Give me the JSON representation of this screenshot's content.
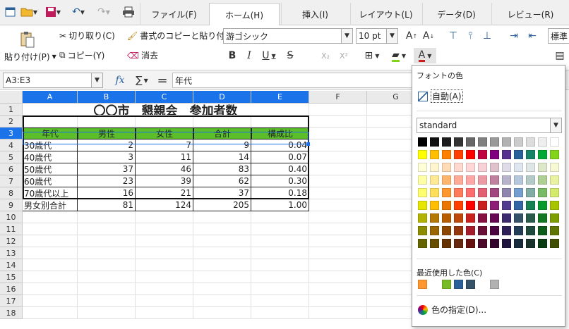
{
  "tabs": [
    "ファイル(F)",
    "ホーム(H)",
    "挿入(I)",
    "レイアウト(L)",
    "データ(D)",
    "レビュー(R)"
  ],
  "active_tab": 1,
  "ribbon": {
    "paste": "貼り付け(P)",
    "cut": "切り取り(C)",
    "copy": "コピー(Y)",
    "clone": "書式のコピーと貼り付け",
    "clear": "消去",
    "font_name": "游ゴシック",
    "font_size": "10 pt",
    "style": "標準"
  },
  "formula": {
    "cell_ref": "A3:E3",
    "content": "年代",
    "fx": "fx",
    "sigma": "∑",
    "eq": "="
  },
  "columns": [
    "A",
    "B",
    "C",
    "D",
    "E",
    "F",
    "G"
  ],
  "rows": [
    "1",
    "2",
    "3",
    "4",
    "5",
    "6",
    "7",
    "8",
    "9",
    "10",
    "11",
    "12",
    "13",
    "14",
    "15",
    "16",
    "17",
    "18"
  ],
  "sheet": {
    "title": "〇〇市　懇親会　参加者数",
    "headers": [
      "年代",
      "男性",
      "女性",
      "合計",
      "構成比"
    ],
    "data": [
      [
        "30歳代",
        "2",
        "7",
        "9",
        "0.04"
      ],
      [
        "40歳代",
        "3",
        "11",
        "14",
        "0.07"
      ],
      [
        "50歳代",
        "37",
        "46",
        "83",
        "0.40"
      ],
      [
        "60歳代",
        "23",
        "39",
        "62",
        "0.30"
      ],
      [
        "70歳代以上",
        "16",
        "21",
        "37",
        "0.18"
      ],
      [
        "男女別合計",
        "81",
        "124",
        "205",
        "1.00"
      ]
    ]
  },
  "popup": {
    "title": "フォントの色",
    "auto": "自動(A)",
    "palette_name": "standard",
    "recent_label": "最近使用した色(C)",
    "custom": "色の指定(D)...",
    "palette": [
      [
        "#000000",
        "#111111",
        "#1c1c1c",
        "#333333",
        "#666666",
        "#808080",
        "#999999",
        "#b2b2b2",
        "#cccccc",
        "#dddddd",
        "#eeeeee",
        "#ffffff"
      ],
      [
        "#ffff00",
        "#ffbf00",
        "#ff8000",
        "#ff4000",
        "#ff0000",
        "#bf0041",
        "#800080",
        "#55308d",
        "#2a6099",
        "#158466",
        "#00a933",
        "#81d41a"
      ],
      [
        "#ffffd7",
        "#fff5ce",
        "#ffdbb6",
        "#ffd8ce",
        "#ffd7d7",
        "#f7d1d5",
        "#e0c2cd",
        "#dedce6",
        "#dee6ef",
        "#dee7e5",
        "#dde8cb",
        "#f6f9d4"
      ],
      [
        "#ffffa6",
        "#ffe994",
        "#ffb66c",
        "#ffaa95",
        "#ffa6a6",
        "#ec9ba4",
        "#bf819e",
        "#b7b3ca",
        "#b4c7dc",
        "#b3cac7",
        "#afd095",
        "#e8f2a1"
      ],
      [
        "#ffff6d",
        "#ffde59",
        "#ff972f",
        "#ff7b59",
        "#ff6d6d",
        "#e16173",
        "#a1467e",
        "#8e86ae",
        "#729fcf",
        "#81aca6",
        "#77bc65",
        "#d4ea6b"
      ],
      [
        "#e6e600",
        "#ffbf00",
        "#ea7500",
        "#ff4000",
        "#ff0000",
        "#c9211e",
        "#8d1d75",
        "#523b8f",
        "#3465a4",
        "#168253",
        "#069a2e",
        "#a6c500"
      ],
      [
        "#b2b200",
        "#b47804",
        "#b85c00",
        "#be480a",
        "#c9211e",
        "#861141",
        "#650953",
        "#3b2a6e",
        "#355269",
        "#2a5a4b",
        "#127622",
        "#7d9d00"
      ],
      [
        "#8c8c00",
        "#996600",
        "#8d4600",
        "#93360c",
        "#a51d2d",
        "#6b0f36",
        "#4c0742",
        "#2f1f57",
        "#233d56",
        "#1e4a3d",
        "#0e5c19",
        "#5f7600"
      ],
      [
        "#666600",
        "#664d00",
        "#663300",
        "#66290f",
        "#66110f",
        "#4d0a2a",
        "#33052d",
        "#1f143d",
        "#172b3d",
        "#17332b",
        "#0a3d11",
        "#3f4e00"
      ]
    ],
    "recent": [
      "#ff972f",
      "#ffffff",
      "#77bc25",
      "#2a6099",
      "#355269",
      "#ffffff",
      "#b2b2b2"
    ]
  }
}
